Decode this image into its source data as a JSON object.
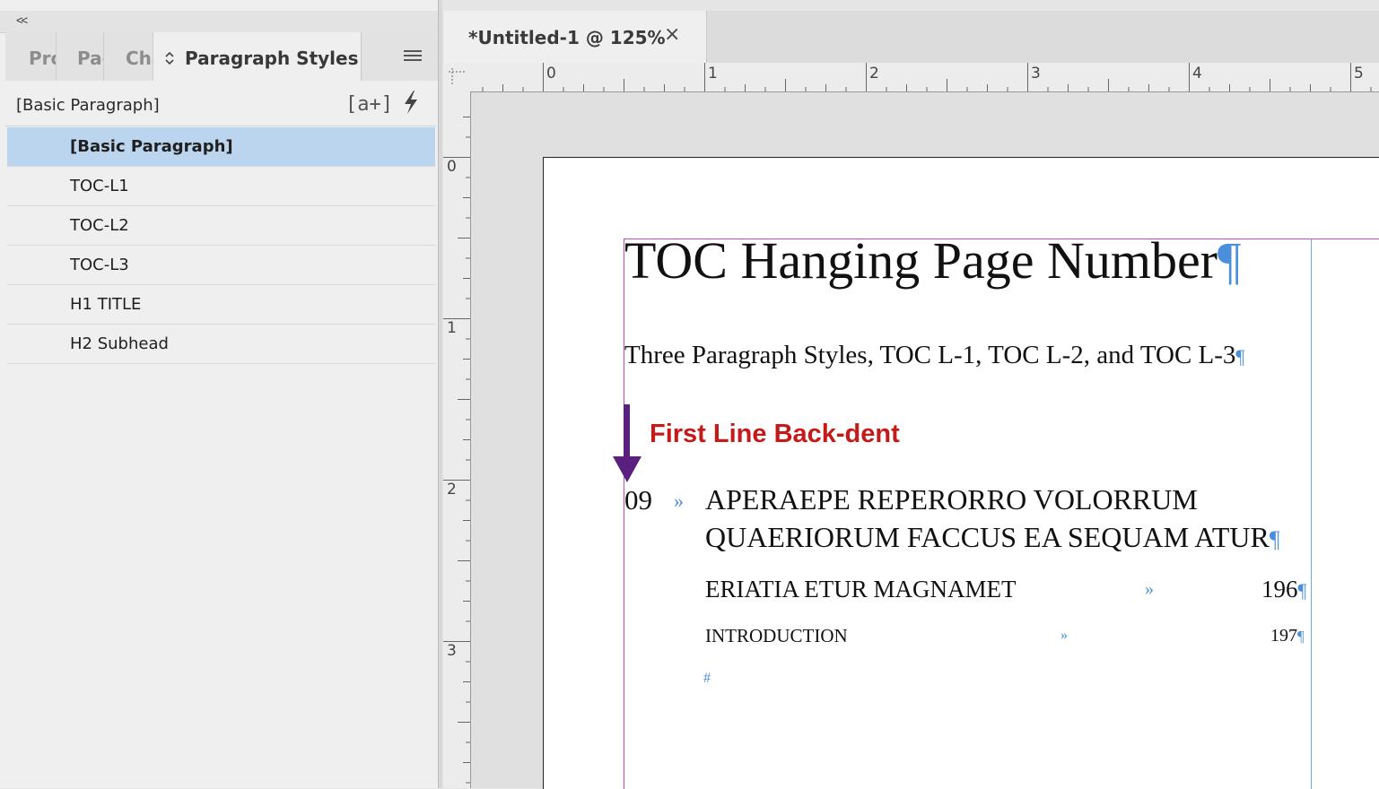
{
  "panel": {
    "collapse_icon": "<<",
    "tabs": [
      {
        "label": "Properties",
        "icon": null
      },
      {
        "label": "Pages",
        "icon": null
      },
      {
        "label": "Character",
        "icon": null
      },
      {
        "label": "Paragraph Styles",
        "icon": "up-down-chevron-icon"
      }
    ],
    "menu_icon": "hamburger-menu-icon",
    "current_style": "[Basic Paragraph]",
    "new_style_icon": "[a+]",
    "quick_apply_icon": "lightning-icon",
    "styles": [
      {
        "label": "[Basic Paragraph]",
        "selected": true
      },
      {
        "label": "TOC-L1",
        "selected": false
      },
      {
        "label": "TOC-L2",
        "selected": false
      },
      {
        "label": "TOC-L3",
        "selected": false
      },
      {
        "label": "H1 TITLE",
        "selected": false
      },
      {
        "label": "H2 Subhead",
        "selected": false
      }
    ]
  },
  "document": {
    "tab_title": "*Untitled-1 @ 125%",
    "close_icon": "×",
    "h_ruler_labels": [
      "0",
      "1",
      "2",
      "3",
      "4",
      "5"
    ],
    "v_ruler_labels": [
      "0",
      "1",
      "2",
      "3"
    ],
    "title": "TOC Hanging Page Number",
    "subtitle": "Three Paragraph Styles, TOC L-1, TOC L-2, and TOC L-3",
    "annotation": "First Line Back-dent",
    "annotation_color": "#c41a1a",
    "arrow_color": "#5b1f7f",
    "toc1": {
      "number": "09",
      "line1": "APERAEPE REPERORRO VOLORRUM",
      "line2": "QUAERIORUM FACCUS EA SEQUAM ATUR"
    },
    "toc2": {
      "text": "ERIATIA ETUR MAGNAMET",
      "page": "196"
    },
    "toc3": {
      "text": "INTRODUCTION",
      "page": "197"
    },
    "tab_char": "»",
    "pilcrow": "¶",
    "end_marker": "#"
  }
}
